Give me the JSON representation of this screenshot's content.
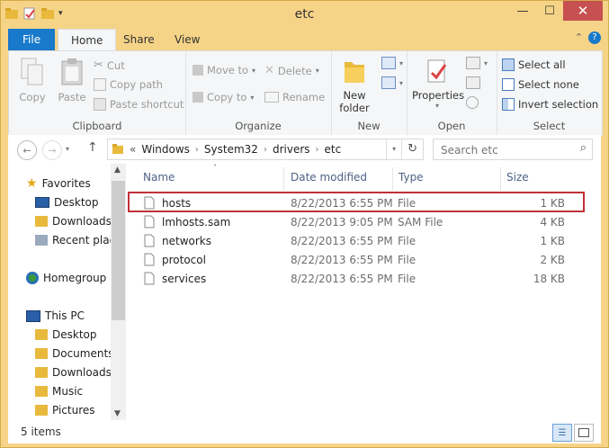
{
  "window": {
    "title": "etc",
    "minimize": "—",
    "maximize": "☐",
    "close": "✕"
  },
  "tabs": [
    "File",
    "Home",
    "Share",
    "View"
  ],
  "ribbon": {
    "clipboard": {
      "label": "Clipboard",
      "copy": "Copy",
      "paste": "Paste",
      "cut": "Cut",
      "copy_path": "Copy path",
      "paste_shortcut": "Paste shortcut"
    },
    "organize": {
      "label": "Organize",
      "move_to": "Move to",
      "copy_to": "Copy to",
      "delete": "Delete",
      "rename": "Rename"
    },
    "new": {
      "label": "New",
      "new_folder_line1": "New",
      "new_folder_line2": "folder"
    },
    "open": {
      "label": "Open",
      "properties": "Properties"
    },
    "select": {
      "label": "Select",
      "select_all": "Select all",
      "select_none": "Select none",
      "invert": "Invert selection"
    }
  },
  "address": {
    "overflow": "«",
    "crumbs": [
      "Windows",
      "System32",
      "drivers",
      "etc"
    ],
    "search_placeholder": "Search etc"
  },
  "nav_pane": {
    "favorites": "Favorites",
    "fav_items": [
      "Desktop",
      "Downloads",
      "Recent plac"
    ],
    "homegroup": "Homegroup",
    "this_pc": "This PC",
    "pc_items": [
      "Desktop",
      "Documents",
      "Downloads",
      "Music",
      "Pictures"
    ]
  },
  "columns": {
    "name": "Name",
    "date": "Date modified",
    "type": "Type",
    "size": "Size"
  },
  "files": [
    {
      "name": "hosts",
      "date": "8/22/2013 6:55 PM",
      "type": "File",
      "size": "1 KB"
    },
    {
      "name": "lmhosts.sam",
      "date": "8/22/2013 9:05 PM",
      "type": "SAM File",
      "size": "4 KB"
    },
    {
      "name": "networks",
      "date": "8/22/2013 6:55 PM",
      "type": "File",
      "size": "1 KB"
    },
    {
      "name": "protocol",
      "date": "8/22/2013 6:55 PM",
      "type": "File",
      "size": "2 KB"
    },
    {
      "name": "services",
      "date": "8/22/2013 6:55 PM",
      "type": "File",
      "size": "18 KB"
    }
  ],
  "status": {
    "count": "5 items"
  },
  "colors": {
    "file_tab": "#1979ca",
    "titlebar": "#f6d487",
    "highlight": "#c0313a",
    "close_btn": "#c75050"
  }
}
